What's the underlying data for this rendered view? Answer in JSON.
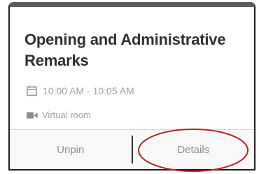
{
  "session": {
    "title": "Opening and Administrative Remarks",
    "time_range": "10:00 AM - 10:05 AM",
    "location": "Virtual room"
  },
  "actions": {
    "unpin_label": "Unpin",
    "details_label": "Details"
  },
  "icons": {
    "time": "calendar-icon",
    "location": "video-camera-icon"
  },
  "annotation": {
    "highlight_color": "#b4222a",
    "highlight_target": "details-button"
  }
}
